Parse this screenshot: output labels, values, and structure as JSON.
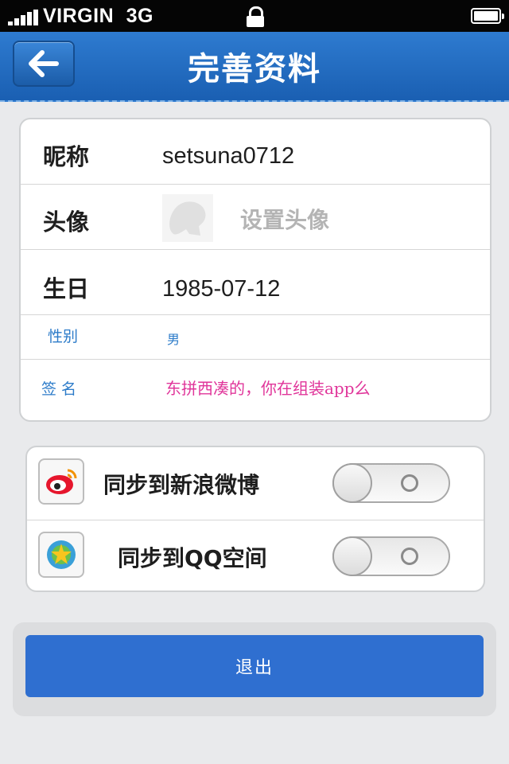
{
  "status_bar": {
    "carrier": "VIRGIN",
    "network": "3G"
  },
  "nav": {
    "title": "完善资料"
  },
  "profile": {
    "nickname": {
      "label": "昵称",
      "value": "setsuna0712"
    },
    "avatar": {
      "label": "头像",
      "placeholder": "设置头像"
    },
    "birthday": {
      "label": "生日",
      "value": "1985-07-12"
    },
    "gender": {
      "label": "性别",
      "value": "男"
    },
    "signature": {
      "label": "签名",
      "value": "东拼西凑的，你在组装app么"
    }
  },
  "sync": {
    "weibo": {
      "label": "同步到新浪微博",
      "enabled": false
    },
    "qzone": {
      "label": "同步到QQ空间",
      "enabled": false
    }
  },
  "logout": {
    "label": "退出"
  },
  "colors": {
    "nav": "#1f66bd",
    "accent_blue": "#2c7bc9",
    "pink": "#e0359a",
    "logout": "#2f6fd0"
  }
}
